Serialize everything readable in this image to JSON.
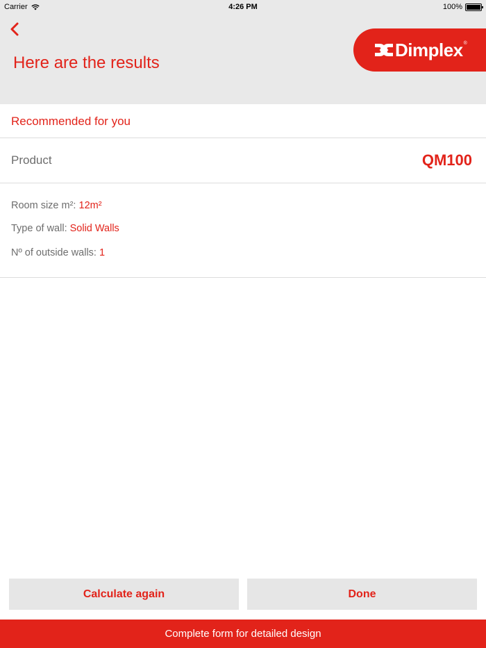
{
  "status_bar": {
    "carrier": "Carrier",
    "time": "4:26 PM",
    "battery": "100%"
  },
  "header": {
    "title": "Here are the results",
    "back_icon": "chevron-left-icon",
    "logo_text": "Dimplex",
    "logo_registered": "®"
  },
  "section": {
    "title": "Recommended for you"
  },
  "product": {
    "label": "Product",
    "value": "QM100"
  },
  "details": {
    "room_size_label": "Room size m²:",
    "room_size_value": "12m²",
    "wall_type_label": "Type of wall:",
    "wall_type_value": "Solid Walls",
    "outside_walls_label": "Nº of outside walls:",
    "outside_walls_value": "1"
  },
  "buttons": {
    "calculate_again": "Calculate again",
    "done": "Done",
    "complete_form": "Complete form for detailed design"
  },
  "colors": {
    "accent": "#e2231a",
    "header_bg": "#e9e9e9",
    "button_bg": "#e6e6e6",
    "label_text": "#6d6d6d"
  }
}
